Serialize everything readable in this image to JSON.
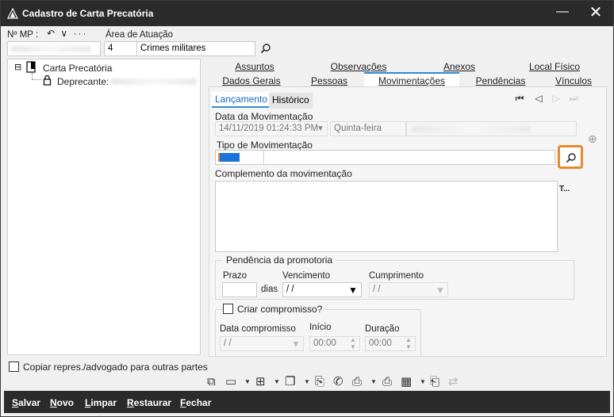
{
  "window": {
    "title": "Cadastro de Carta Precatória",
    "minimize_glyph": "—",
    "close_glyph": "✕"
  },
  "header": {
    "mp_label": "Nº MP :",
    "mp_tools": "↶ ∨ ···",
    "area_label": "Área de Atuação",
    "area_code": "4",
    "area_name": "Crimes militares"
  },
  "tree": {
    "root_label": "Carta Precatória",
    "root_toggle": "⊟",
    "child_label": "Deprecante:"
  },
  "left_footer": {
    "checkbox_label": "Copiar repres./advogado para outras partes"
  },
  "tabs_row1": [
    "Assuntos",
    "Observações",
    "Anexos",
    "Local Físico"
  ],
  "tabs_row2": [
    "Dados Gerais",
    "Pessoas",
    "Movimentações",
    "Pendências",
    "Vínculos"
  ],
  "subtabs": [
    "Lançamento",
    "Histórico"
  ],
  "nav": {
    "first": "⏮",
    "prev": "◁",
    "next": "▷",
    "last": "⏭"
  },
  "form": {
    "data_label": "Data da Movimentação",
    "data_value": "14/11/2019 01:24:33 PM",
    "weekday": "Quinta-feira",
    "tipo_label": "Tipo de Movimentação",
    "complemento_label": "Complemento da movimentação",
    "side_marker": "T...",
    "add_glyph": "⊕"
  },
  "pendencia": {
    "group_title": "Pendência da promotoria",
    "prazo_label": "Prazo",
    "dias_label": "dias",
    "vencimento_label": "Vencimento",
    "vencimento_value": " /  /",
    "cumprimento_label": "Cumprimento",
    "cumprimento_value": " /  /"
  },
  "compromisso": {
    "checkbox_label": "Criar compromisso?",
    "data_label": "Data compromisso",
    "data_value": " /  /",
    "inicio_label": "Início",
    "inicio_value": "00:00",
    "duracao_label": "Duração",
    "duracao_value": "00:00"
  },
  "bottom_buttons": [
    {
      "key": "S",
      "rest": "alvar"
    },
    {
      "key": "N",
      "rest": "ovo"
    },
    {
      "key": "L",
      "rest": "impar"
    },
    {
      "key": "R",
      "rest": "estaurar"
    },
    {
      "key": "F",
      "rest": "echar"
    }
  ],
  "colors": {
    "accent": "#2e8ad6",
    "search_highlight": "#e8892c",
    "titlebar": "#2b2b2b",
    "type_chip": "#1a73d9"
  }
}
